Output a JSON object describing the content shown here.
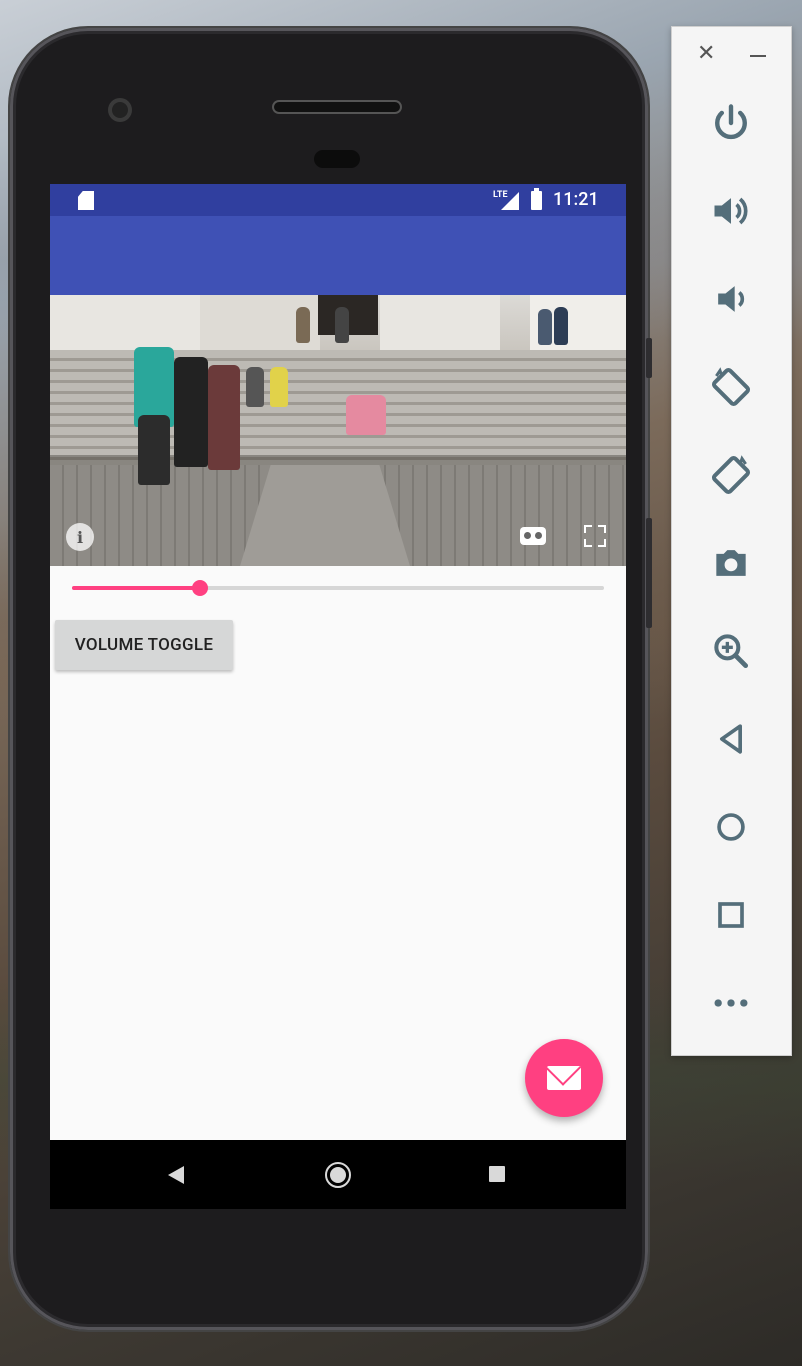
{
  "status_bar": {
    "time": "11:21",
    "network": "LTE"
  },
  "main": {
    "slider": {
      "value_fraction": 0.24
    },
    "volume_button_label": "VOLUME TOGGLE"
  },
  "video": {
    "controls": [
      "info-icon",
      "cardboard-vr-icon",
      "fullscreen-icon"
    ]
  },
  "fab": {
    "icon": "mail-icon",
    "color": "#ff4081"
  },
  "theme": {
    "primary": "#3f51b5",
    "primary_dark": "#303f9f",
    "accent": "#ff4081"
  },
  "emulator_toolbar": {
    "items": [
      "power-icon",
      "volume-up-icon",
      "volume-down-icon",
      "rotate-left-icon",
      "rotate-right-icon",
      "camera-icon",
      "zoom-icon",
      "back-icon",
      "home-icon",
      "overview-icon",
      "more-icon"
    ]
  }
}
